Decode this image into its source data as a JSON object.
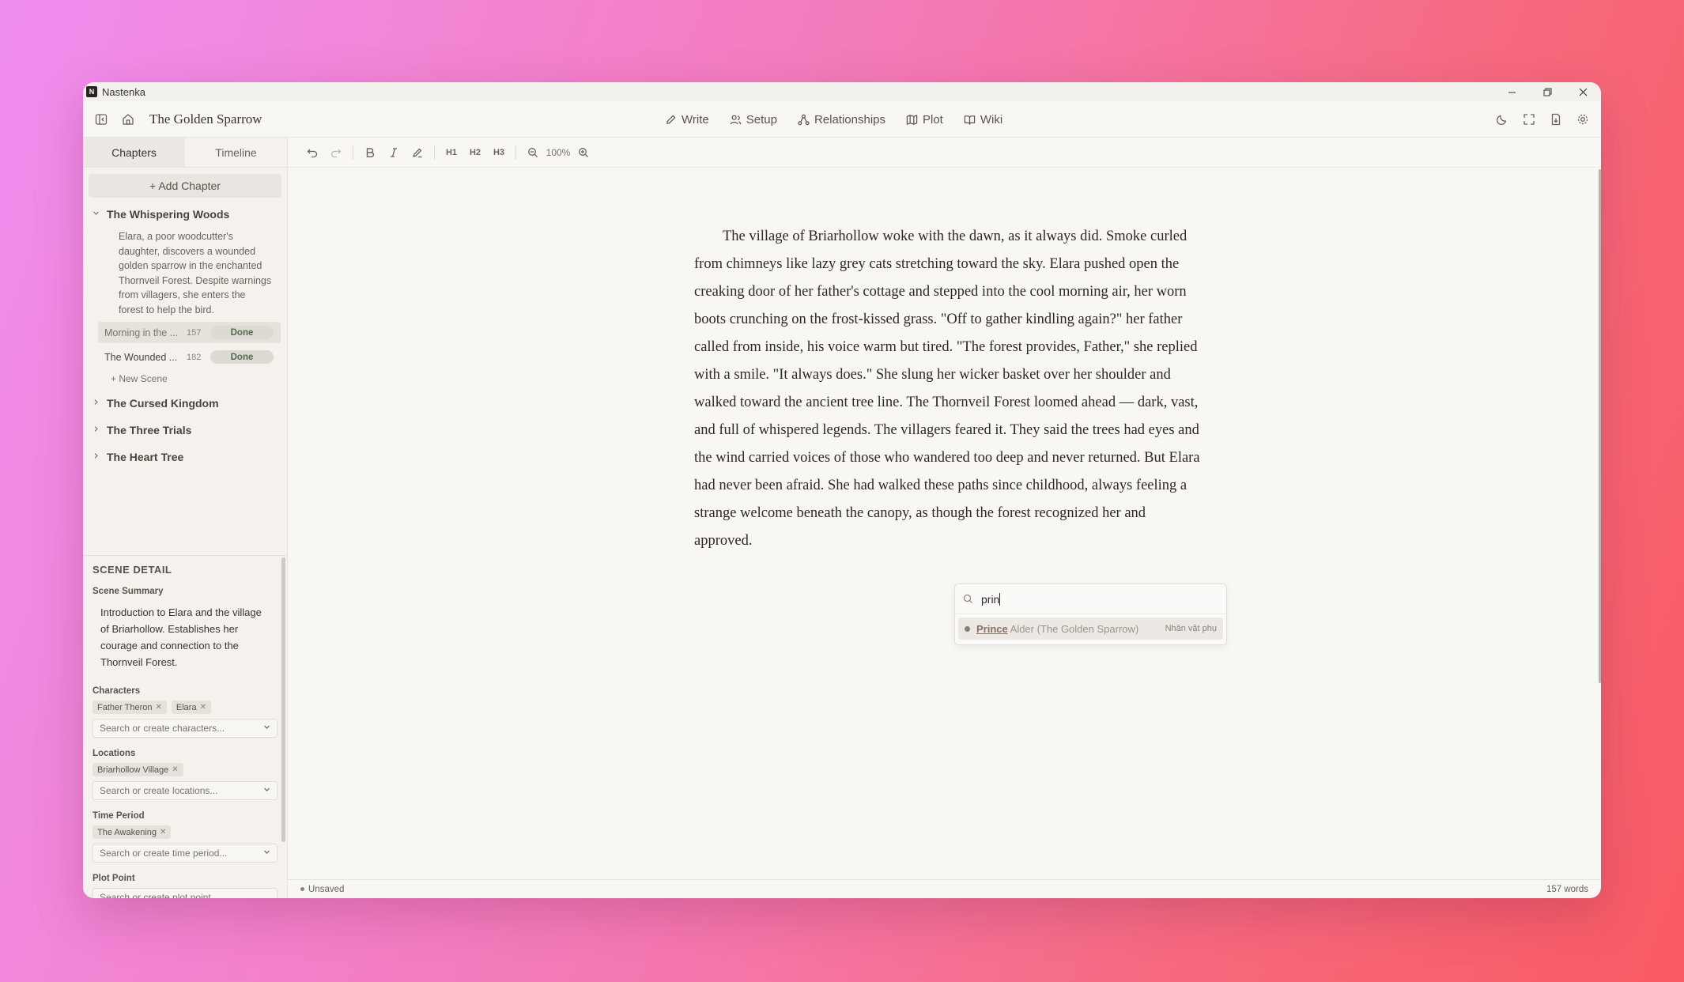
{
  "app": {
    "name": "Nastenka",
    "logo_letter": "N"
  },
  "header": {
    "doc_title": "The Golden Sparrow",
    "nav": [
      {
        "label": "Write",
        "icon": "pen-icon"
      },
      {
        "label": "Setup",
        "icon": "users-icon"
      },
      {
        "label": "Relationships",
        "icon": "network-icon"
      },
      {
        "label": "Plot",
        "icon": "map-icon"
      },
      {
        "label": "Wiki",
        "icon": "book-icon"
      }
    ]
  },
  "sidebar": {
    "tabs": [
      "Chapters",
      "Timeline"
    ],
    "add_chapter": "+ Add Chapter",
    "chapters": [
      {
        "title": "The Whispering Woods",
        "expanded": true,
        "summary": "Elara, a poor woodcutter's daughter, discovers a wounded golden sparrow in the enchanted Thornveil Forest. Despite warnings from villagers, she enters the forest to help the bird.",
        "scenes": [
          {
            "name": "Morning in the ...",
            "count": "157",
            "status": "Done"
          },
          {
            "name": "The Wounded ...",
            "count": "182",
            "status": "Done"
          }
        ],
        "new_scene": "+ New Scene"
      },
      {
        "title": "The Cursed Kingdom"
      },
      {
        "title": "The Three Trials"
      },
      {
        "title": "The Heart Tree"
      }
    ]
  },
  "scene_detail": {
    "title": "SCENE DETAIL",
    "summary_label": "Scene Summary",
    "summary": "Introduction to Elara and the village of Briarhollow. Establishes her courage and connection to the Thornveil Forest.",
    "characters_label": "Characters",
    "characters": [
      "Father Theron",
      "Elara"
    ],
    "characters_placeholder": "Search or create characters...",
    "locations_label": "Locations",
    "locations": [
      "Briarhollow Village"
    ],
    "locations_placeholder": "Search or create locations...",
    "time_label": "Time Period",
    "time_periods": [
      "The Awakening"
    ],
    "time_placeholder": "Search or create time period...",
    "plot_label": "Plot Point",
    "plot_placeholder": "Search or create plot point..."
  },
  "toolbar": {
    "zoom": "100%",
    "h1": "H1",
    "h2": "H2",
    "h3": "H3"
  },
  "editor": {
    "text": "The village of Briarhollow woke with the dawn, as it always did. Smoke curled from chimneys like lazy grey cats stretching toward the sky. Elara pushed open the creaking door of her father's cottage and stepped into the cool morning air, her worn boots crunching on the frost-kissed grass. \"Off to gather kindling again?\" her father called from inside, his voice warm but tired. \"The forest provides, Father,\" she replied with a smile. \"It always does.\" She slung her wicker basket over her shoulder and walked toward the ancient tree line. The Thornveil Forest loomed ahead — dark, vast, and full of whispered legends. The villagers feared it. They said the trees had eyes and the wind carried voices of those who wandered too deep and never returned. But Elara had never been afraid. She had walked these paths since childhood, always feeling a strange welcome beneath the canopy, as though the forest recognized her and approved."
  },
  "mention": {
    "query": "prin",
    "result_match": "Prince",
    "result_rest": " Alder (The Golden Sparrow)",
    "result_role": "Nhân vật phụ"
  },
  "status": {
    "save_state": "Unsaved",
    "word_count": "157 words"
  }
}
